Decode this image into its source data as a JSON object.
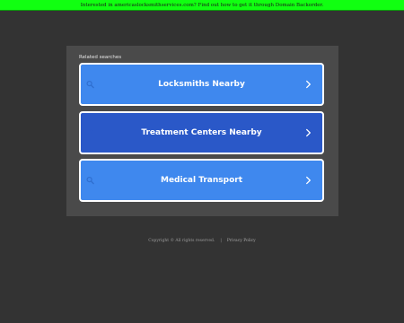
{
  "banner": {
    "text": "Interested in americaslocksmithservices.com? Find out how to get it through Domain Backorder."
  },
  "panel": {
    "heading": "Related searches",
    "results": [
      {
        "label": "Locksmiths Nearby",
        "icon": "search-icon",
        "chevron": "chevron-right-icon"
      },
      {
        "label": "Treatment Centers Nearby",
        "icon": "search-icon",
        "chevron": "chevron-right-icon"
      },
      {
        "label": "Medical Transport",
        "icon": "search-icon",
        "chevron": "chevron-right-icon"
      }
    ]
  },
  "footer": {
    "copyright": "Copyright ©  All rights reserved.",
    "separator": "|",
    "privacy": "Privacy Policy"
  },
  "colors": {
    "page_background": "#333333",
    "banner_background": "#11ff11",
    "panel_background": "#4a4a4a",
    "result_light": "#3f88ee",
    "result_dark": "#2a58c8",
    "result_border": "#ffffff"
  }
}
